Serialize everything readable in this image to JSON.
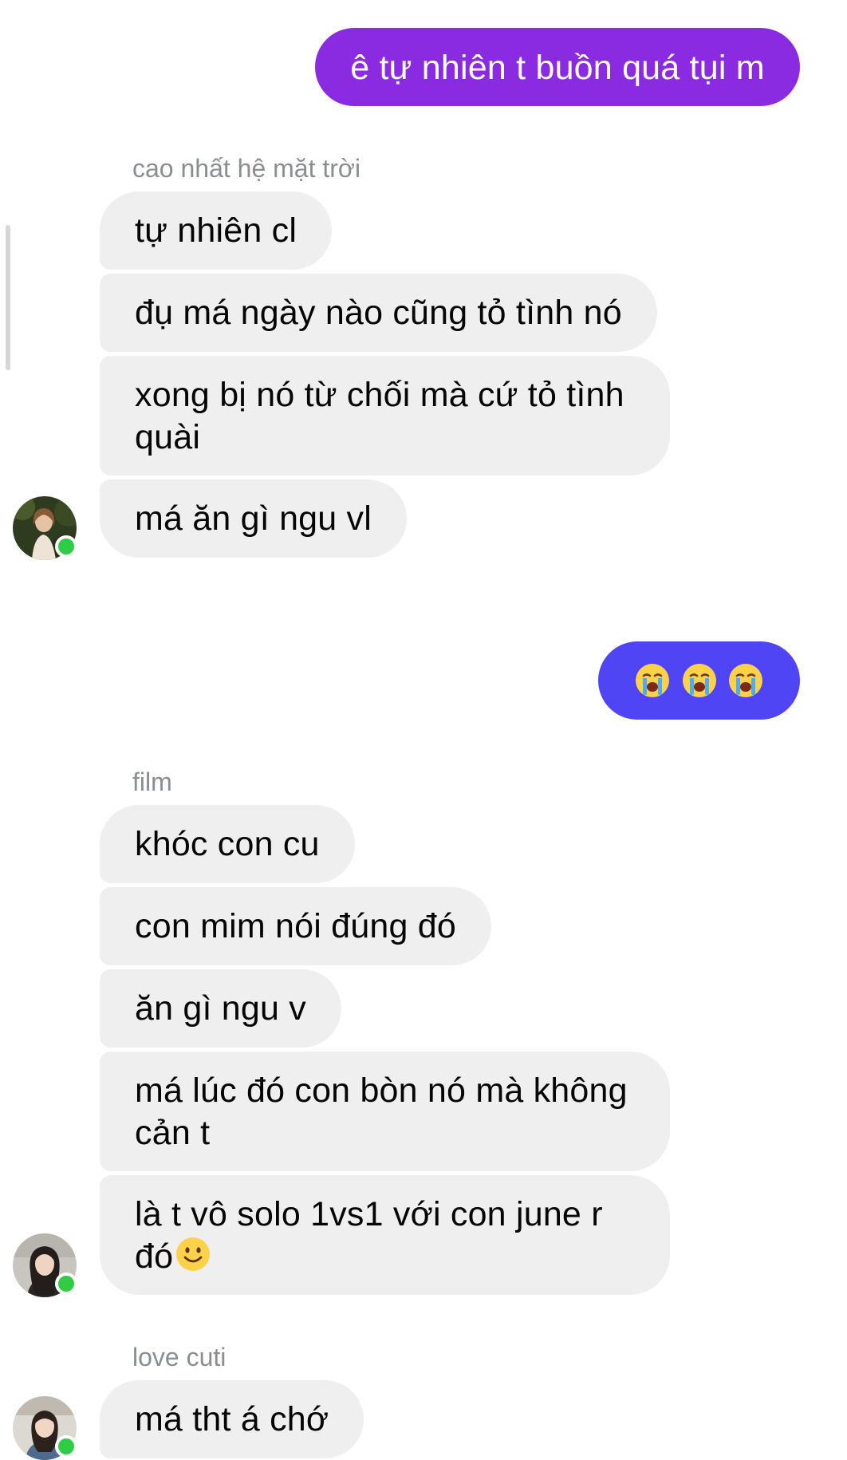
{
  "colors": {
    "outgoing_purple": "#8a2be2",
    "outgoing_blue": "#4f45f5",
    "incoming_bg": "#efefef",
    "online": "#31cc46"
  },
  "messages": [
    {
      "direction": "outgoing",
      "text": "ê tự nhiên t buồn quá tụi m"
    },
    {
      "direction": "incoming",
      "sender": "cao nhất hệ mặt trời",
      "texts": [
        "tự nhiên cl",
        "đụ má ngày nào cũng tỏ tình nó",
        "xong bị nó từ chối mà cứ tỏ tình quài",
        "má ăn gì ngu vl"
      ]
    },
    {
      "direction": "outgoing",
      "emoji": [
        "loudly-crying-face-icon",
        "loudly-crying-face-icon",
        "loudly-crying-face-icon"
      ]
    },
    {
      "direction": "incoming",
      "sender": "film",
      "texts": [
        "khóc con cu",
        "con mim nói đúng đó",
        "ăn gì ngu v",
        "má lúc đó con bòn nó mà không cản t",
        "là t vô solo 1vs1 với con june r đó"
      ],
      "last_emoji": "slightly-smiling-face-icon"
    },
    {
      "direction": "incoming",
      "sender": "love cuti",
      "texts": [
        "má tht á chớ"
      ]
    }
  ]
}
